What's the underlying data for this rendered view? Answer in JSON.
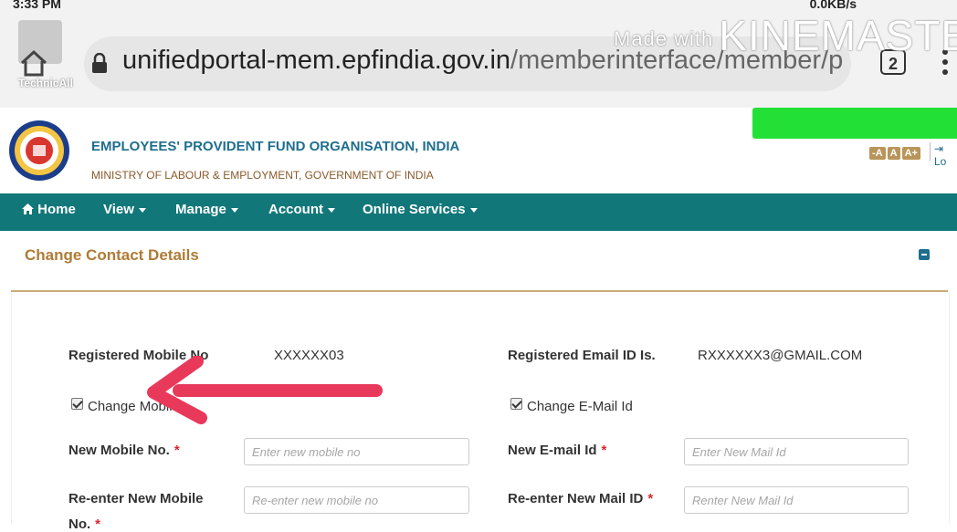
{
  "status_bar": {
    "time": "3:33 PM",
    "net_speed": "0.0KB/s"
  },
  "watermark": {
    "made_with": "Made with",
    "brand": "KINEMASTER"
  },
  "channel": {
    "name": "TechnicAll"
  },
  "browser": {
    "url_host": "unifiedportal-mem.epfindia.gov.in",
    "url_path": "/memberinterface/member/pr",
    "tab_count": "2"
  },
  "header": {
    "org_name": "EMPLOYEES' PROVIDENT FUND ORGANISATION, INDIA",
    "ministry": "MINISTRY OF LABOUR & EMPLOYMENT, GOVERNMENT OF INDIA",
    "font_small": "-A",
    "font_normal": "A",
    "font_large": "A+",
    "logout": "Lo"
  },
  "nav": {
    "home": "Home",
    "items": [
      "View",
      "Manage",
      "Account",
      "Online Services"
    ]
  },
  "panel": {
    "title": "Change Contact Details"
  },
  "form": {
    "registered_mobile_label": "Registered Mobile No",
    "registered_mobile_value": "XXXXXX03",
    "registered_email_label": "Registered Email ID Is.",
    "registered_email_value": "RXXXXXX3@GMAIL.COM",
    "change_mobile_label": "Change Mobile",
    "change_email_label": "Change E-Mail Id",
    "new_mobile_label": "New Mobile No.",
    "new_mobile_placeholder": "Enter new mobile no",
    "new_email_label": "New E-mail Id",
    "new_email_placeholder": "Enter New Mail Id",
    "reenter_mobile_label": "Re-enter New Mobile",
    "reenter_mobile_label_cont": "No.",
    "reenter_mobile_placeholder": "Re-enter new mobile no",
    "reenter_email_label": "Re-enter New Mail ID",
    "reenter_email_placeholder": "Renter New Mail Id",
    "required_mark": "*"
  },
  "colors": {
    "nav_bg": "#127779",
    "title": "#b07b35",
    "org": "#1e6e8e",
    "arrow": "#e8395b",
    "green_bar": "#22e036"
  }
}
